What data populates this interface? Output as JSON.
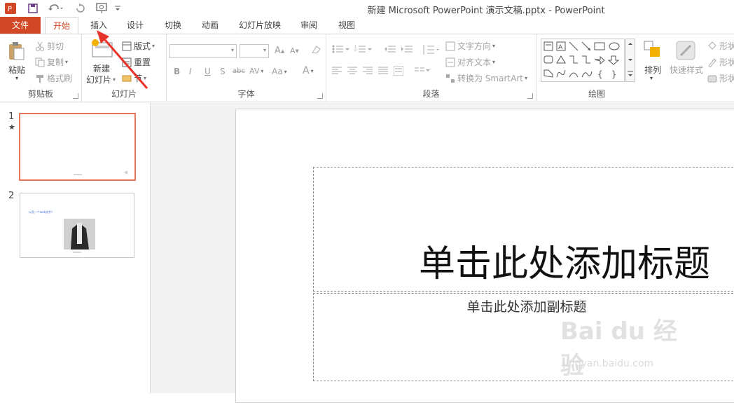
{
  "window": {
    "title": "新建 Microsoft PowerPoint 演示文稿.pptx - PowerPoint"
  },
  "quick_access": {
    "icons": [
      "powerpoint-app-icon",
      "save-icon",
      "undo-icon",
      "redo-icon",
      "present-icon",
      "customize-icon"
    ]
  },
  "tabs": [
    {
      "label": "文件"
    },
    {
      "label": "开始"
    },
    {
      "label": "插入"
    },
    {
      "label": "设计"
    },
    {
      "label": "切换"
    },
    {
      "label": "动画"
    },
    {
      "label": "幻灯片放映"
    },
    {
      "label": "审阅"
    },
    {
      "label": "视图"
    }
  ],
  "ribbon": {
    "clipboard": {
      "paste": "粘贴",
      "cut": "剪切",
      "copy": "复制",
      "format_painter": "格式刷",
      "label": "剪贴板"
    },
    "slides": {
      "new_slide_line1": "新建",
      "new_slide_line2": "幻灯片",
      "layout": "版式",
      "reset": "重置",
      "section": "节",
      "label": "幻灯片"
    },
    "font": {
      "grow": "A",
      "shrink": "A",
      "bold": "B",
      "italic": "I",
      "underline": "U",
      "shadow": "S",
      "strike": "abc",
      "spacing": "AV",
      "case": "Aa",
      "color": "A",
      "label": "字体"
    },
    "paragraph": {
      "text_direction": "文字方向",
      "align_text": "对齐文本",
      "smartart": "转换为 SmartArt",
      "label": "段落"
    },
    "drawing": {
      "arrange": "排列",
      "quick_styles": "快速样式",
      "shape_fill": "形状",
      "shape_outline": "形状",
      "shape_effects": "形状",
      "label": "绘图"
    }
  },
  "thumbnails": [
    {
      "number": "1",
      "caption": ""
    },
    {
      "number": "2",
      "caption": "以及一个web文件)"
    }
  ],
  "slide": {
    "title": "单击此处添加标题",
    "subtitle": "单击此处添加副标题"
  },
  "watermark": {
    "logo": "Bai du 经验",
    "url": "jingyan.baidu.com"
  },
  "colors": {
    "accent": "#d24726",
    "selection": "#e8755a",
    "arrow": "#e8332a"
  }
}
